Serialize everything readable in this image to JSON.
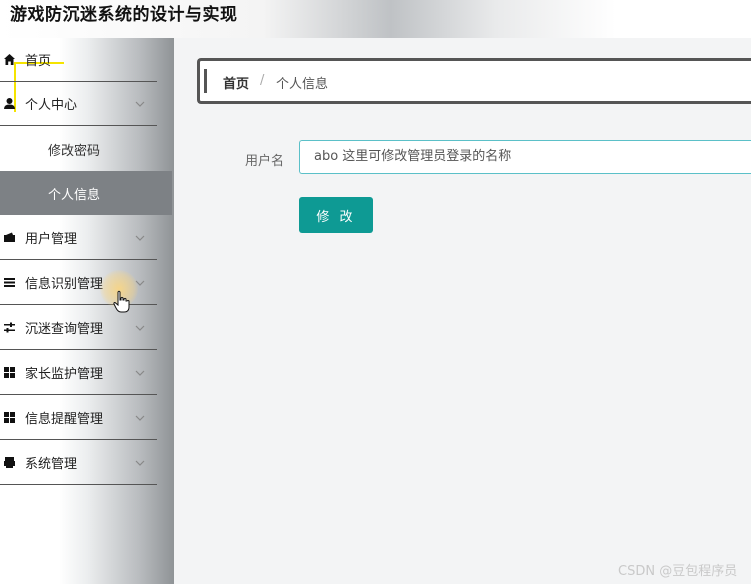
{
  "header": {
    "title": "游戏防沉迷系统的设计与实现"
  },
  "sidebar": {
    "items": [
      {
        "label": "首页",
        "icon": "home-icon"
      },
      {
        "label": "个人中心",
        "icon": "user-icon"
      },
      {
        "label": "用户管理",
        "icon": "wallet-icon"
      },
      {
        "label": "信息识别管理",
        "icon": "list-icon"
      },
      {
        "label": "沉迷查询管理",
        "icon": "sliders-icon"
      },
      {
        "label": "家长监护管理",
        "icon": "grid-icon"
      },
      {
        "label": "信息提醒管理",
        "icon": "grid-icon"
      },
      {
        "label": "系统管理",
        "icon": "printer-icon"
      }
    ],
    "sub_items": [
      {
        "label": "修改密码",
        "active": false
      },
      {
        "label": "个人信息",
        "active": true
      }
    ],
    "active_color": "#7d8185"
  },
  "breadcrumb": {
    "home": "首页",
    "separator": "/",
    "current": "个人信息"
  },
  "form": {
    "username_label": "用户名",
    "username_value": "abo 这里可修改管理员登录的名称",
    "submit_label": "修 改",
    "accent_color": "#0e9a94"
  },
  "watermark": "CSDN @豆包程序员"
}
